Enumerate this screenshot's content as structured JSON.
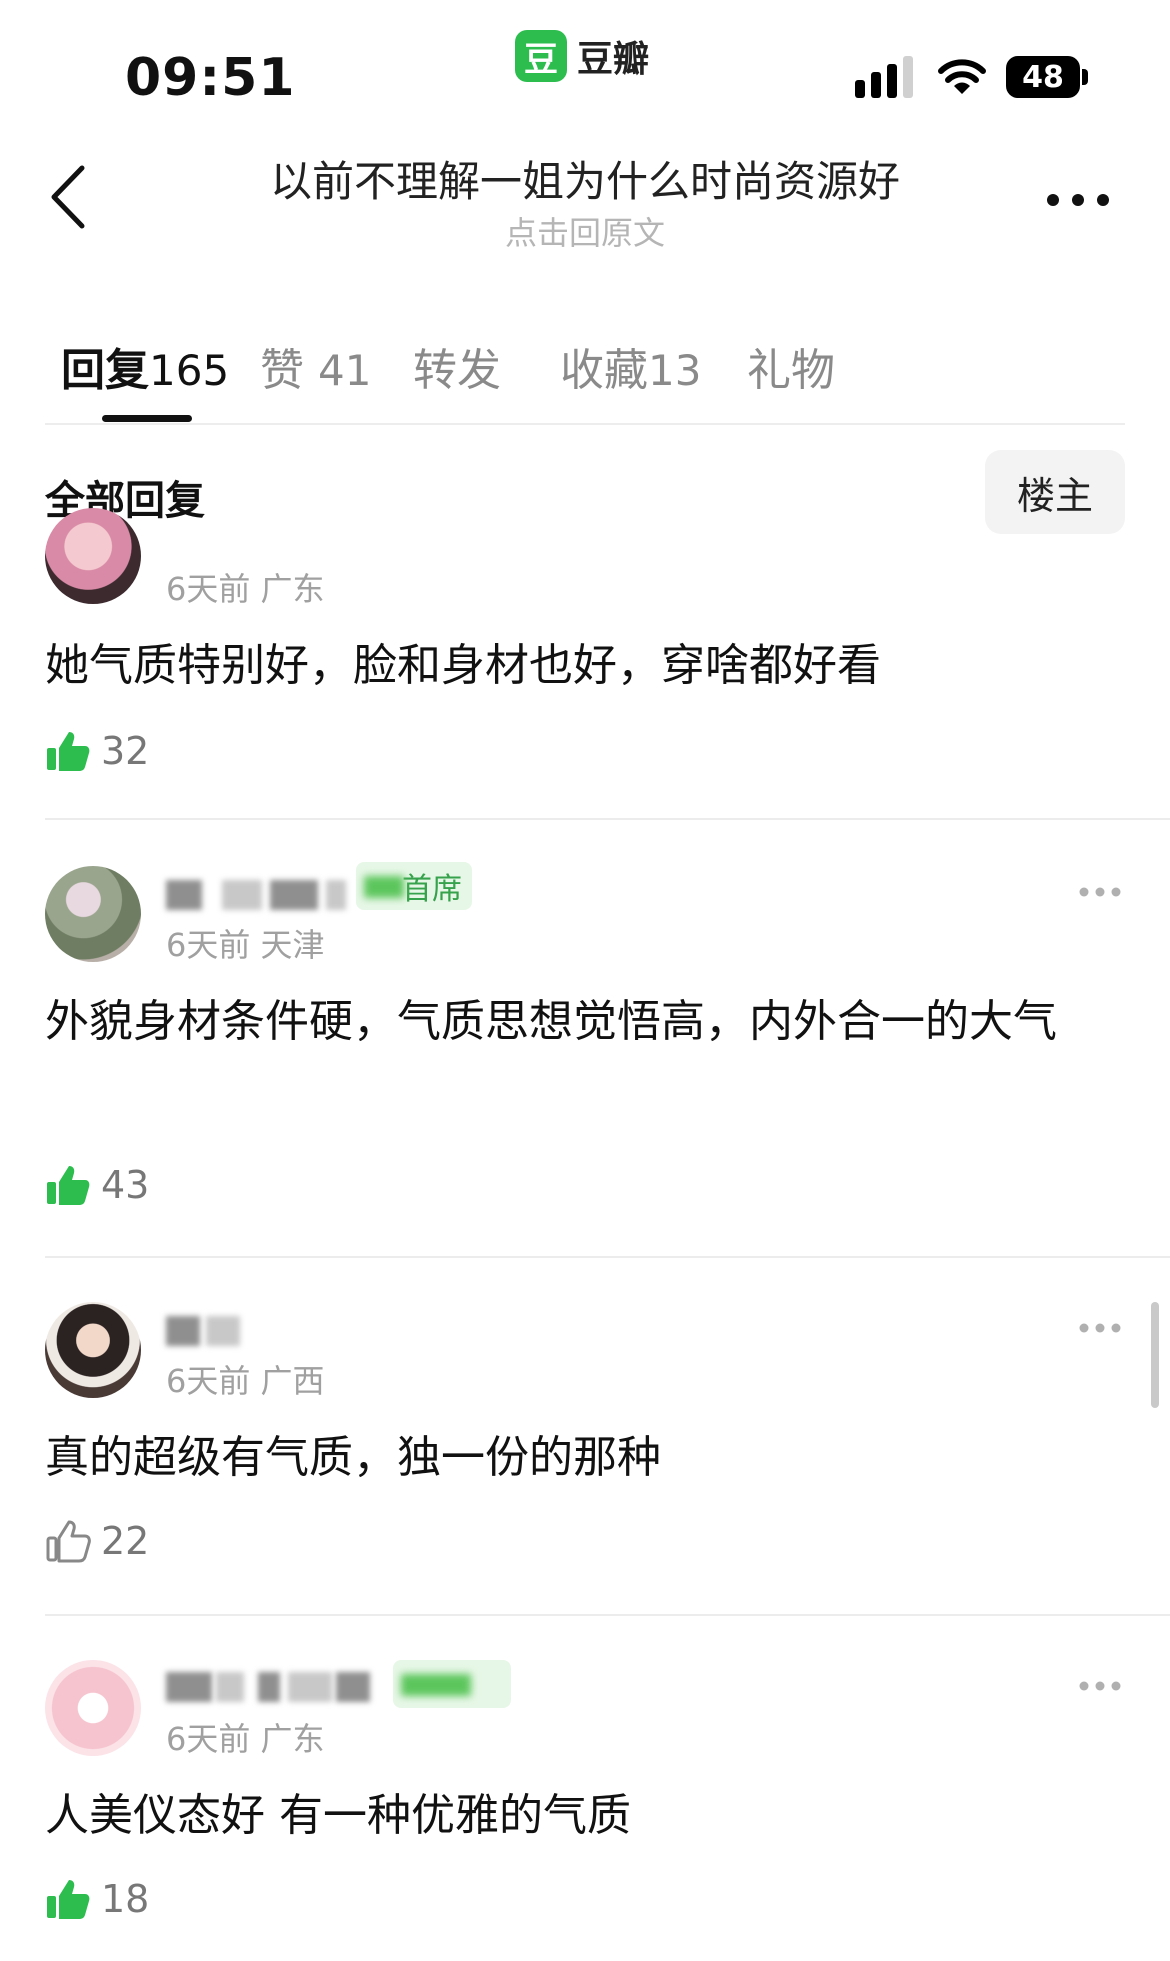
{
  "status_bar": {
    "time": "09:51",
    "app_logo_glyph": "豆",
    "app_name": "豆瓣",
    "battery": "48",
    "icons": [
      "signal-icon",
      "wifi-icon",
      "battery-icon"
    ]
  },
  "nav": {
    "title": "以前不理解一姐为什么时尚资源好",
    "subtitle": "点击回原文",
    "icons": [
      "back-arrow-icon",
      "more-icon"
    ]
  },
  "tabs": [
    {
      "label": "回复",
      "count": "165",
      "active": true
    },
    {
      "label": "赞",
      "count": "41",
      "active": false
    },
    {
      "label": "转发",
      "count": "",
      "active": false
    },
    {
      "label": "收藏",
      "count": "13",
      "active": false
    },
    {
      "label": "礼物",
      "count": "",
      "active": false
    }
  ],
  "filter": {
    "title": "全部回复",
    "op_button": "楼主"
  },
  "comments": [
    {
      "meta": "6天前 广东",
      "text": "她气质特别好，脸和身材也好，穿啥都好看",
      "likes": "32",
      "liked": true
    },
    {
      "badge": "首席",
      "meta": "6天前 天津",
      "text": "外貌身材条件硬，气质思想觉悟高，内外合一的大气",
      "likes": "43",
      "liked": true
    },
    {
      "meta": "6天前 广西",
      "text": "真的超级有气质，独一份的那种",
      "likes": "22",
      "liked": false
    },
    {
      "meta": "6天前 广东",
      "text": "人美仪态好 有一种优雅的气质",
      "likes": "18",
      "liked": true
    }
  ],
  "colors": {
    "accent_green": "#2dbd4f",
    "muted_text": "#a0a0a0"
  }
}
